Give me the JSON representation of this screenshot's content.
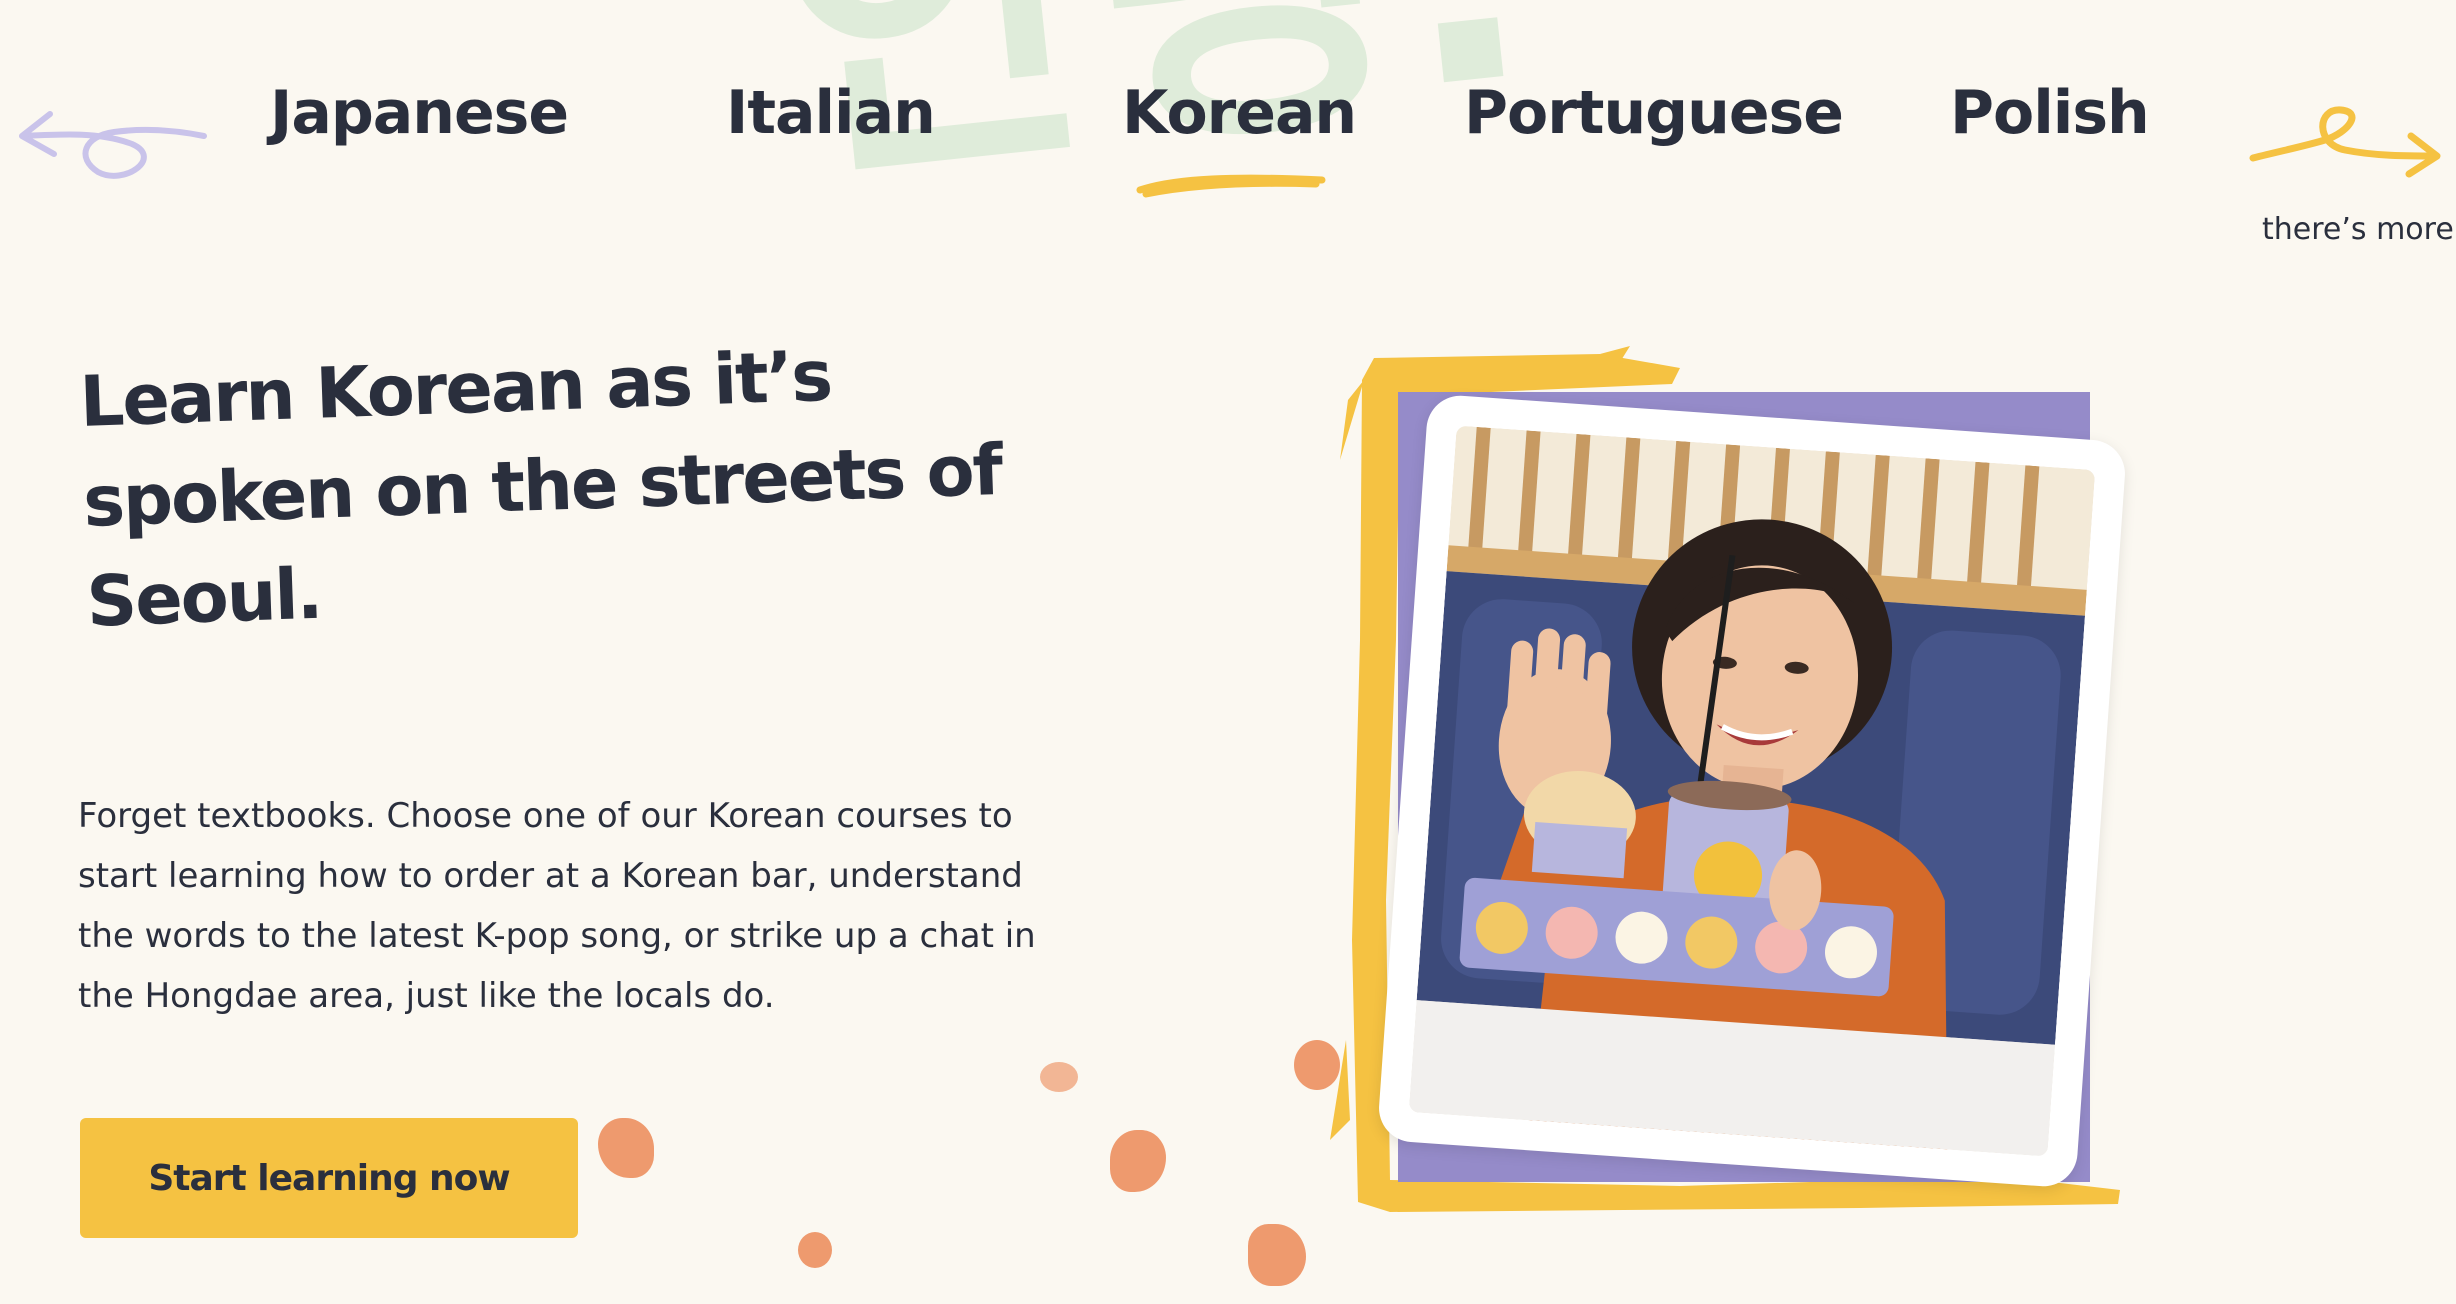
{
  "nav": {
    "languages": [
      {
        "label": "Japanese"
      },
      {
        "label": "Italian"
      },
      {
        "label": "Korean"
      },
      {
        "label": "Portuguese"
      },
      {
        "label": "Polish"
      }
    ],
    "active_language": "Korean",
    "more_label": "there’s more",
    "prev_arrow_icon": "scribble-left-arrow-icon",
    "next_arrow_icon": "scribble-right-arrow-icon"
  },
  "background_word": "안녕!",
  "hero": {
    "headline": "Learn Korean as it’s spoken on the streets of Seoul.",
    "description": "Forget textbooks. Choose one of our Korean courses to start learning how to order at a Korean bar, understand the words to the latest K-pop song, or strike up a chat in the Hongdae area, just like the locals do.",
    "cta_label": "Start learning now"
  },
  "colors": {
    "background": "#fbf8f1",
    "text": "#2a2f3d",
    "accent_yellow": "#f5c242",
    "frame_purple": "#958bc9",
    "splash_orange": "#ee9a6e",
    "left_arrow_lilac": "#c9c3ea",
    "background_word_green": "#dcebd8"
  }
}
